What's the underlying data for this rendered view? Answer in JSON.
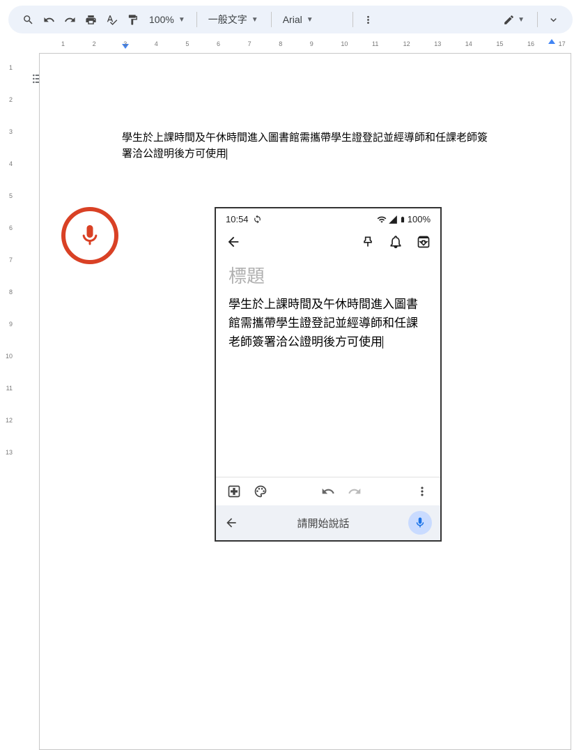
{
  "toolbar": {
    "zoom": "100%",
    "style": "一般文字",
    "font": "Arial"
  },
  "ruler": {
    "h": [
      1,
      2,
      3,
      4,
      5,
      6,
      7,
      8,
      9,
      10,
      11,
      12,
      13,
      14,
      15,
      16,
      17
    ],
    "v": [
      1,
      2,
      3,
      4,
      5,
      6,
      7,
      8,
      9,
      10,
      11,
      12,
      13
    ]
  },
  "doc": {
    "text": "學生於上課時間及午休時間進入圖書館需攜帶學生證登記並經導師和任課老師簽署洽公證明後方可使用"
  },
  "phone": {
    "time": "10:54",
    "battery": "100%",
    "title_placeholder": "標題",
    "body": "學生於上課時間及午休時間進入圖書館需攜帶學生證登記並經導師和任課老師簽署洽公證明後方可使用",
    "voice_prompt": "請開始說話"
  }
}
